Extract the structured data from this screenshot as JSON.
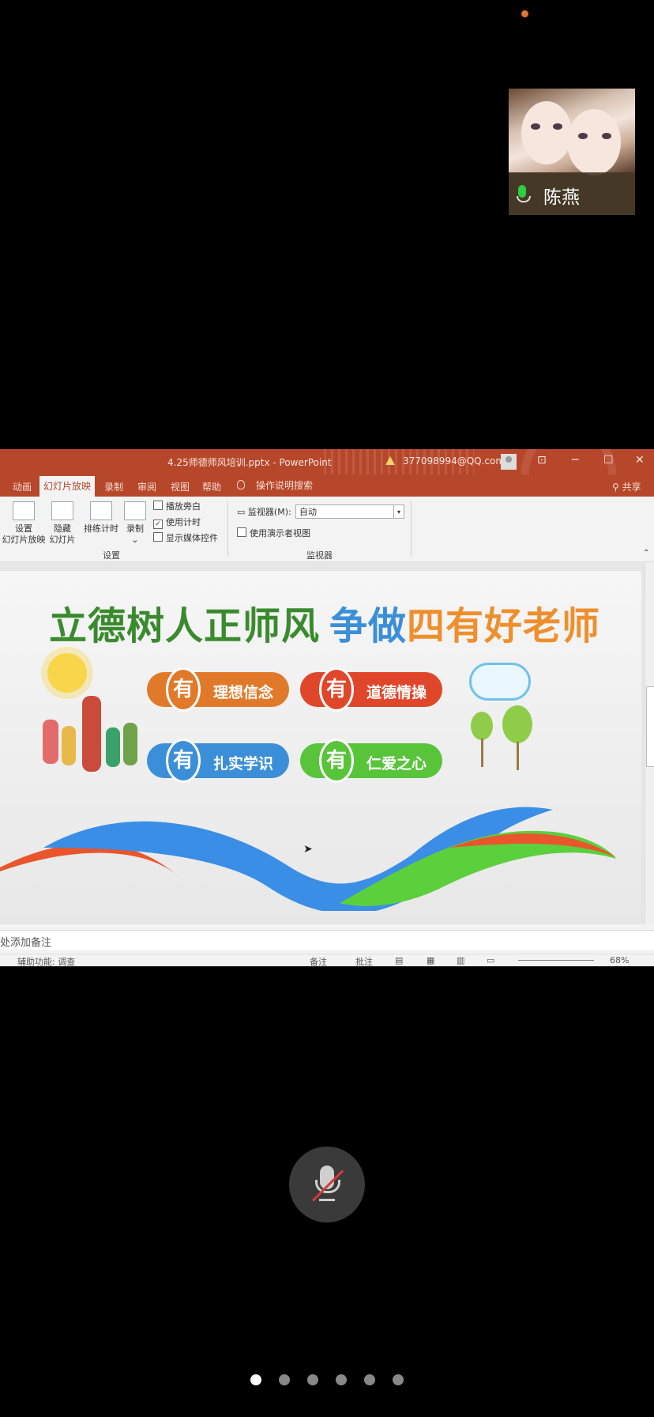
{
  "meeting": {
    "participant_name": "陈燕",
    "page_dots": [
      true,
      false,
      false,
      false,
      false,
      false
    ]
  },
  "powerpoint": {
    "document_title": "4.25师德师风培训.pptx  -  PowerPoint",
    "account": "377098994@QQ.com",
    "tabs": [
      "动画",
      "幻灯片放映",
      "录制",
      "审阅",
      "视图",
      "帮助"
    ],
    "tell_me": "操作说明搜索",
    "share": "共享",
    "ribbon": {
      "setup_button": [
        "设置",
        "幻灯片放映"
      ],
      "hide_button": [
        "隐藏",
        "幻灯片"
      ],
      "rehearse_button": "排练计时",
      "record_button": "录制",
      "checkbox_narration": "播放旁白",
      "checkbox_timings": "使用计时",
      "checkbox_media": "显示媒体控件",
      "group_setup": "设置",
      "monitor_label": "监视器(M):",
      "monitor_value": "自动",
      "presenter_view": "使用演示者视图",
      "group_monitors": "监视器"
    },
    "slide": {
      "heading_part1": "立德树人正师风",
      "heading_part2": "争做",
      "heading_part3": "四有好老师",
      "badge_char": "有",
      "pills": [
        "理想信念",
        "道德情操",
        "扎实学识",
        "仁爱之心"
      ]
    },
    "notes_placeholder": "处添加备注",
    "status": {
      "accessibility": "辅助功能: 调查",
      "notes": "备注",
      "comments": "批注",
      "zoom": "68%"
    }
  },
  "colors": {
    "ppt_accent": "#b7472a",
    "pill_orange": "#e07a2a",
    "pill_red": "#e0462a",
    "pill_blue": "#3b8fd8",
    "pill_green": "#58c43a",
    "mute_slash": "#d23a3a"
  }
}
